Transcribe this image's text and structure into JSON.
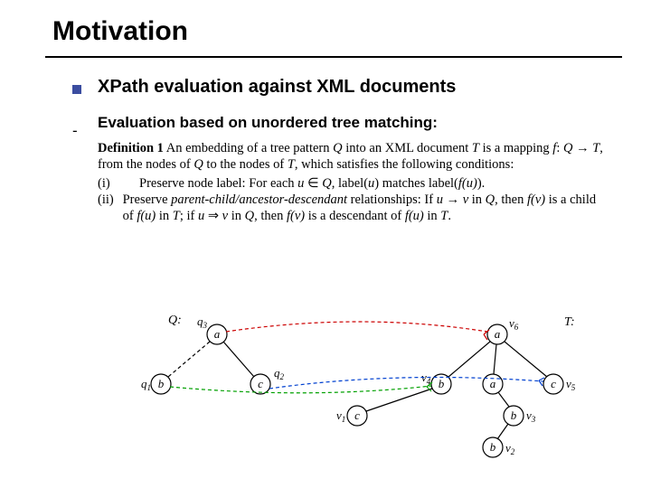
{
  "title": "Motivation",
  "heading1": "XPath evaluation against XML documents",
  "heading2": "Evaluation based on unordered tree matching:",
  "definition": {
    "head": "Definition 1",
    "body_pre": " An embedding of a tree pattern ",
    "Q": "Q",
    "body_mid1": " into an XML document ",
    "T": "T",
    "body_mid2": " is a mapping ",
    "f": "f",
    "colon": ": ",
    "arrow1": " → ",
    "body_mid3": ", from the nodes of ",
    "body_mid4": " to the nodes of ",
    "body_mid5": ", which satisfies the following conditions:",
    "cond_i_num": "(i)",
    "cond_i_text_a": "Preserve node label: For each ",
    "u": "u",
    "in": " ∈ ",
    "cond_i_text_b": ", label(",
    "cond_i_text_c": ") matches label(",
    "cond_i_text_d": ").",
    "fu": "f(u)",
    "cond_ii_num": "(ii)",
    "cond_ii_text_a": "Preserve ",
    "pcad": "parent-child/ancestor-descendant",
    "cond_ii_text_b": " relationships: If ",
    "v": "v",
    "cond_ii_text_b2": " in ",
    "cond_ii_text_c": ", then ",
    "fv": "f(v)",
    "cond_ii_text_d": " is a child of ",
    "cond_ii_text_e": " in ",
    "cond_ii_text_f": "; if ",
    "dblarrow": " ⇒ ",
    "cond_ii_text_g": " in ",
    "cond_ii_text_h": ", then ",
    "cond_ii_text_i": " is a descendant of ",
    "cond_ii_text_j": " in ",
    "period": "."
  },
  "diagram": {
    "Q_label": "Q:",
    "T_label": "T:",
    "nodes": {
      "q3": {
        "label": "a",
        "sub": "q",
        "subn": "3"
      },
      "q1": {
        "label": "b",
        "sub": "q",
        "subn": "1"
      },
      "q2": {
        "label": "c",
        "sub": "q",
        "subn": "2"
      },
      "v6": {
        "label": "a",
        "sub": "v",
        "subn": "6"
      },
      "v4": {
        "label": "b",
        "sub": "v",
        "subn": "4"
      },
      "v5": {
        "label": "c",
        "sub": "v",
        "subn": "5"
      },
      "v3": {
        "label": "b",
        "sub": "v",
        "subn": "3"
      },
      "v1": {
        "label": "c",
        "sub": "v",
        "subn": "1"
      },
      "v2": {
        "label": "b",
        "sub": "v",
        "subn": "2"
      }
    }
  }
}
